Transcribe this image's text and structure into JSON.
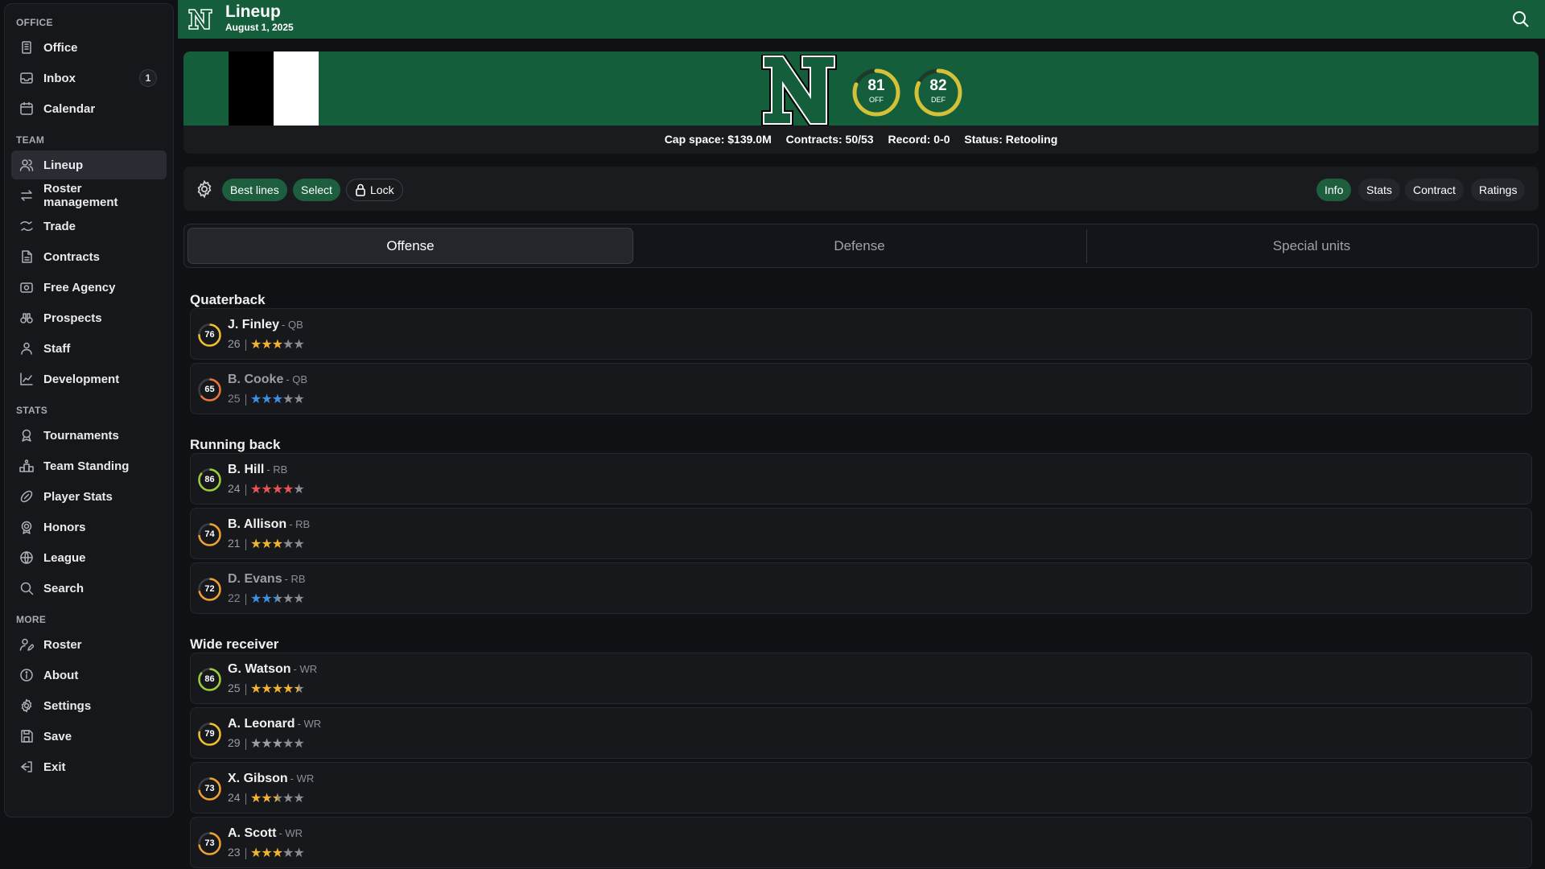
{
  "sidebar": {
    "sections": [
      {
        "label": "OFFICE",
        "items": [
          {
            "label": "Office",
            "icon": "building-icon"
          },
          {
            "label": "Inbox",
            "icon": "inbox-icon",
            "badge": "1"
          },
          {
            "label": "Calendar",
            "icon": "calendar-icon"
          }
        ]
      },
      {
        "label": "TEAM",
        "items": [
          {
            "label": "Lineup",
            "icon": "users-icon",
            "active": true
          },
          {
            "label": "Roster management",
            "icon": "arrows-icon"
          },
          {
            "label": "Trade",
            "icon": "trade-icon"
          },
          {
            "label": "Contracts",
            "icon": "document-icon"
          },
          {
            "label": "Free Agency",
            "icon": "id-card-icon"
          },
          {
            "label": "Prospects",
            "icon": "binoculars-icon"
          },
          {
            "label": "Staff",
            "icon": "user-tie-icon"
          },
          {
            "label": "Development",
            "icon": "chart-icon"
          }
        ]
      },
      {
        "label": "STATS",
        "items": [
          {
            "label": "Tournaments",
            "icon": "award-icon"
          },
          {
            "label": "Team Standing",
            "icon": "podium-icon"
          },
          {
            "label": "Player Stats",
            "icon": "football-icon"
          },
          {
            "label": "Honors",
            "icon": "medal-icon"
          },
          {
            "label": "League",
            "icon": "globe-icon"
          },
          {
            "label": "Search",
            "icon": "search-icon"
          }
        ]
      },
      {
        "label": "MORE",
        "items": [
          {
            "label": "Roster",
            "icon": "user-edit-icon"
          },
          {
            "label": "About",
            "icon": "info-icon"
          },
          {
            "label": "Settings",
            "icon": "gear-icon"
          },
          {
            "label": "Save",
            "icon": "save-icon"
          },
          {
            "label": "Exit",
            "icon": "exit-icon"
          }
        ]
      }
    ]
  },
  "header": {
    "title": "Lineup",
    "date": "August 1, 2025"
  },
  "banner": {
    "off_rating": "81",
    "off_label": "OFF",
    "def_rating": "82",
    "def_label": "DEF",
    "cap_space": "Cap space: $139.0M",
    "contracts": "Contracts: 50/53",
    "record": "Record: 0-0",
    "status": "Status: Retooling",
    "colors": {
      "primary": "#155e3c",
      "ring": "#d4c13a"
    }
  },
  "toolbar": {
    "best_lines": "Best lines",
    "select": "Select",
    "lock": "Lock",
    "info": "Info",
    "stats": "Stats",
    "contract": "Contract",
    "ratings": "Ratings"
  },
  "tabs": [
    "Offense",
    "Defense",
    "Special units"
  ],
  "groups": [
    {
      "title": "Quaterback",
      "players": [
        {
          "rating": 76,
          "name": "J. Finley",
          "pos": "- QB",
          "age": "26",
          "stars": 3,
          "star_color": "#f2b233",
          "dim": false
        },
        {
          "rating": 65,
          "name": "B. Cooke",
          "pos": "- QB",
          "age": "25",
          "stars": 3,
          "star_color": "#3d8fe0",
          "dim": true
        }
      ]
    },
    {
      "title": "Running back",
      "players": [
        {
          "rating": 86,
          "name": "B. Hill",
          "pos": "- RB",
          "age": "24",
          "stars": 4,
          "star_color": "#e85454",
          "dim": false
        },
        {
          "rating": 74,
          "name": "B. Allison",
          "pos": "- RB",
          "age": "21",
          "stars": 3,
          "star_color": "#f2b233",
          "dim": false
        },
        {
          "rating": 72,
          "name": "D. Evans",
          "pos": "- RB",
          "age": "22",
          "stars": 2.5,
          "star_color": "#3d8fe0",
          "dim": true
        }
      ]
    },
    {
      "title": "Wide receiver",
      "players": [
        {
          "rating": 86,
          "name": "G. Watson",
          "pos": "- WR",
          "age": "25",
          "stars": 4.5,
          "star_color": "#f2b233",
          "dim": false
        },
        {
          "rating": 79,
          "name": "A. Leonard",
          "pos": "- WR",
          "age": "29",
          "stars": 3,
          "star_color": "#9c9ea5",
          "dim": false
        },
        {
          "rating": 73,
          "name": "X. Gibson",
          "pos": "- WR",
          "age": "24",
          "stars": 2.5,
          "star_color": "#f2b233",
          "dim": false
        },
        {
          "rating": 73,
          "name": "A. Scott",
          "pos": "- WR",
          "age": "23",
          "stars": 3,
          "star_color": "#f2b233",
          "dim": false
        }
      ]
    }
  ]
}
